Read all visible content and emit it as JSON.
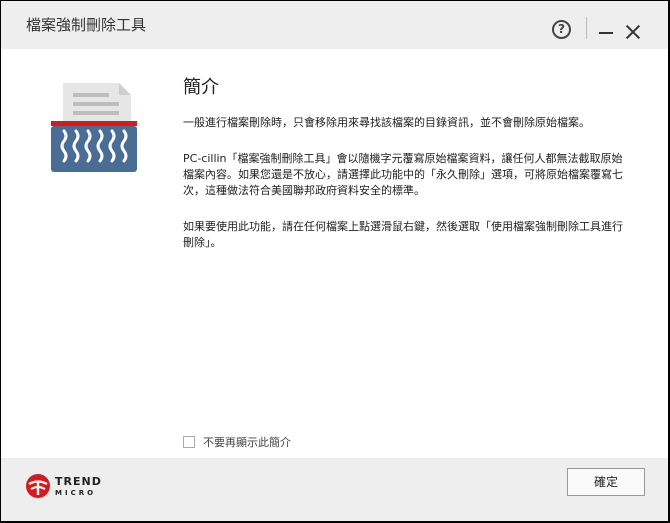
{
  "window": {
    "title": "檔案強制刪除工具"
  },
  "titlebar": {
    "help_label": "?"
  },
  "content": {
    "heading": "簡介",
    "paragraphs": [
      "一般進行檔案刪除時，只會移除用來尋找該檔案的目錄資訊，並不會刪除原始檔案。",
      "PC-cillin「檔案強制刪除工具」會以隨機字元覆寫原始檔案資料，讓任何人都無法截取原始檔案內容。如果您還是不放心，請選擇此功能中的「永久刪除」選項，可將原始檔案覆寫七次，這種做法符合美國聯邦政府資料安全的標準。",
      "如果要使用此功能，請在任何檔案上點選滑鼠右鍵，然後選取「使用檔案強制刪除工具進行刪除」。"
    ]
  },
  "checkbox": {
    "label": "不要再顯示此簡介",
    "checked": false
  },
  "footer": {
    "logo_line1": "TREND",
    "logo_line2": "MICRO",
    "ok_label": "確定"
  },
  "colors": {
    "brand_red": "#d71920",
    "icon_blue": "#4a6d96",
    "titlebar_bg": "#eeeeee"
  }
}
